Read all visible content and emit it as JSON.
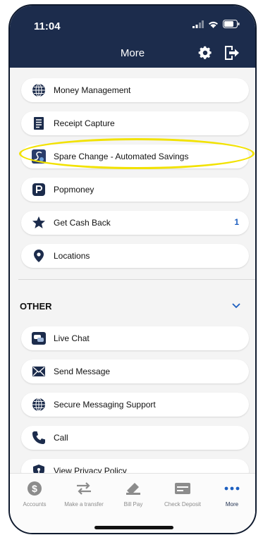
{
  "status_bar": {
    "time": "11:04"
  },
  "header": {
    "title": "More"
  },
  "menu": {
    "items": [
      {
        "label": "Money Management",
        "icon": "globe-icon"
      },
      {
        "label": "Receipt Capture",
        "icon": "receipt-icon"
      },
      {
        "label": "Spare Change - Automated Savings",
        "icon": "spare-change-icon"
      },
      {
        "label": "Popmoney",
        "icon": "popmoney-icon"
      },
      {
        "label": "Get Cash Back",
        "icon": "star-icon",
        "count": "1"
      },
      {
        "label": "Locations",
        "icon": "location-pin-icon"
      }
    ]
  },
  "other": {
    "title": "OTHER",
    "items": [
      {
        "label": "Live Chat",
        "icon": "chat-icon"
      },
      {
        "label": "Send Message",
        "icon": "envelope-icon"
      },
      {
        "label": "Secure Messaging Support",
        "icon": "globe-icon"
      },
      {
        "label": "Call",
        "icon": "phone-icon"
      },
      {
        "label": "View Privacy Policy",
        "icon": "shield-icon"
      }
    ]
  },
  "tabs": [
    {
      "label": "Accounts",
      "icon": "dollar-icon"
    },
    {
      "label": "Make a transfer",
      "icon": "transfer-arrows-icon"
    },
    {
      "label": "Bill Pay",
      "icon": "bill-pay-icon"
    },
    {
      "label": "Check Deposit",
      "icon": "check-deposit-icon"
    },
    {
      "label": "More",
      "icon": "more-dots-icon",
      "active": true
    }
  ],
  "colors": {
    "header": "#1c2c4c",
    "accent": "#1d5fc0",
    "highlight": "#f2e200"
  }
}
